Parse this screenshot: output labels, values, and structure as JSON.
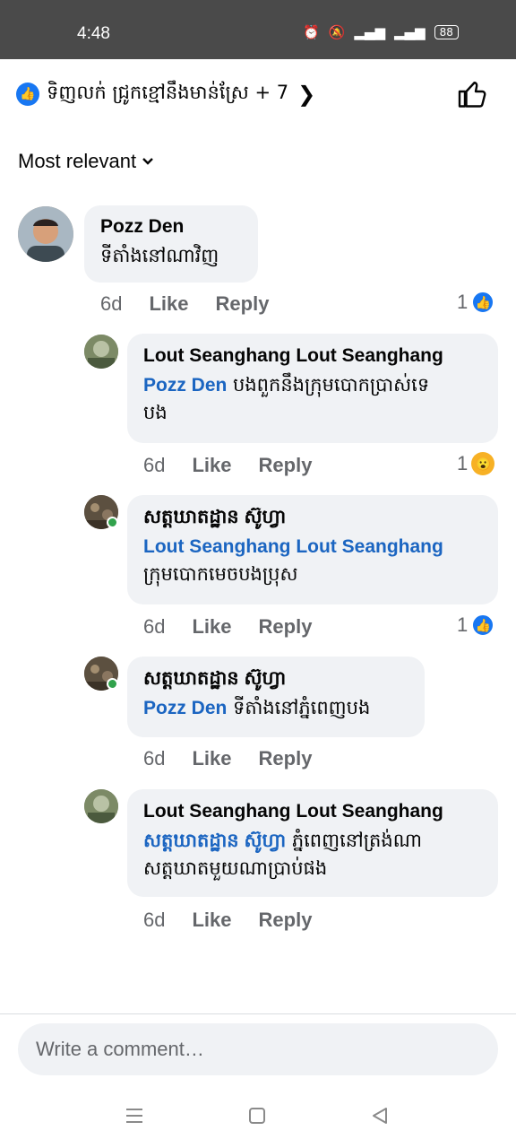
{
  "status_bar": {
    "time": "4:48",
    "battery": "88"
  },
  "header": {
    "reactors": "ទិញលក់ ជ្រូកខ្មៅនឹងមាន់ស្រែ + 7"
  },
  "sort": {
    "label": "Most relevant"
  },
  "comments": [
    {
      "name": "Pozz Den",
      "text": "ទីតាំងនៅណាវិញ",
      "time": "6d",
      "like": "Like",
      "reply": "Reply",
      "react_count": "1"
    },
    {
      "name": "Lout Seanghang Lout Seanghang",
      "mention": "Pozz Den",
      "text": " បងពួកនឹងក្រុមបោកប្រាស់ទេ",
      "text2": "បង",
      "time": "6d",
      "like": "Like",
      "reply": "Reply",
      "react_count": "1"
    },
    {
      "name": "សត្តឃាតដ្ឋាន ស៊ូហ្វា",
      "mention": "Lout Seanghang Lout Seanghang",
      "text": "ក្រុមបោកមេចបងប្រុស",
      "time": "6d",
      "like": "Like",
      "reply": "Reply",
      "react_count": "1"
    },
    {
      "name": "សត្តឃាតដ្ឋាន ស៊ូហ្វា",
      "mention": "Pozz Den",
      "text": " ទីតាំងនៅភ្នំពេញបង",
      "time": "6d",
      "like": "Like",
      "reply": "Reply"
    },
    {
      "name": "Lout Seanghang Lout Seanghang",
      "mention": "សត្តឃាតដ្ឋាន ស៊ូហ្វា",
      "text": " ភ្នំពេញនៅត្រង់ណា",
      "text2": "សត្តឃាតមួយណាប្រាប់ផង",
      "time": "6d",
      "like": "Like",
      "reply": "Reply"
    }
  ],
  "composer": {
    "placeholder": "Write a comment…"
  },
  "colors": {
    "accent": "#1877f2",
    "mention": "#1b65c1",
    "bubble": "#f0f2f5",
    "muted": "#65676b"
  },
  "icons": [
    "like-icon",
    "chevron-right-icon",
    "thumbs-up-icon",
    "chevron-down-icon",
    "wow-reaction-icon",
    "menu-nav-icon",
    "home-nav-icon",
    "back-nav-icon"
  ]
}
